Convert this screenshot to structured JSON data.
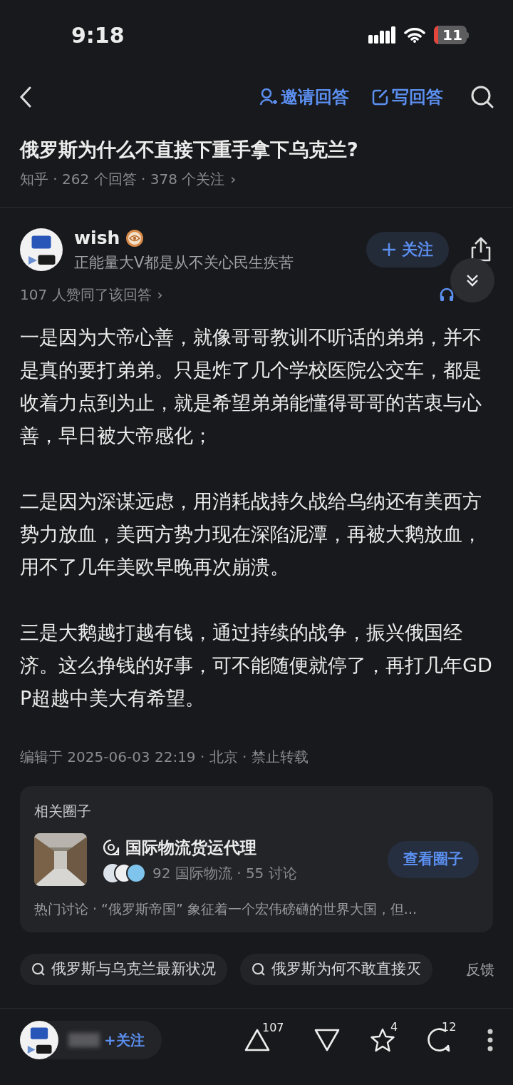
{
  "status_bar": {
    "time": "9:18",
    "battery": "11"
  },
  "nav": {
    "invite": "邀请回答",
    "write": "写回答"
  },
  "question": {
    "title": "俄罗斯为什么不直接下重手拿下乌克兰?",
    "meta": "知乎 · 262 个回答 · 378 个关注",
    "chevron": "›"
  },
  "author": {
    "name": "wish",
    "bio": "正能量大V都是从不关心民生疾苦",
    "follow": "关注"
  },
  "likes": {
    "text": "107 人赞同了该回答",
    "chevron": "›"
  },
  "paragraphs": [
    "一是因为大帝心善，就像哥哥教训不听话的弟弟，并不是真的要打弟弟。只是炸了几个学校医院公交车，都是收着力点到为止，就是希望弟弟能懂得哥哥的苦衷与心善，早日被大帝感化；",
    "二是因为深谋远虑，用消耗战持久战给乌纳还有美西方势力放血，美西方势力现在深陷泥潭，再被大鹅放血，用不了几年美欧早晚再次崩溃。",
    "三是大鹅越打越有钱，通过持续的战争，振兴俄国经济。这么挣钱的好事，可不能随便就停了，再打几年GDP超越中美大有希望。"
  ],
  "edit_info": "编辑于 2025-06-03 22:19 · 北京 · 禁止转载",
  "circle_card": {
    "heading": "相关圈子",
    "name": "国际物流货运代理",
    "stats": "92 国际物流 · 55 讨论",
    "button": "查看圈子",
    "hot": "热门讨论 · “俄罗斯帝国” 象征着一个宏伟磅礴的世界大国，但..."
  },
  "search_chips": [
    "俄罗斯与乌克兰最新状况",
    "俄罗斯为何不敢直接灭"
  ],
  "feedback": "反馈",
  "bottom_bar": {
    "follow": "+关注",
    "upvotes": "107",
    "favorites": "4",
    "comments": "12"
  }
}
